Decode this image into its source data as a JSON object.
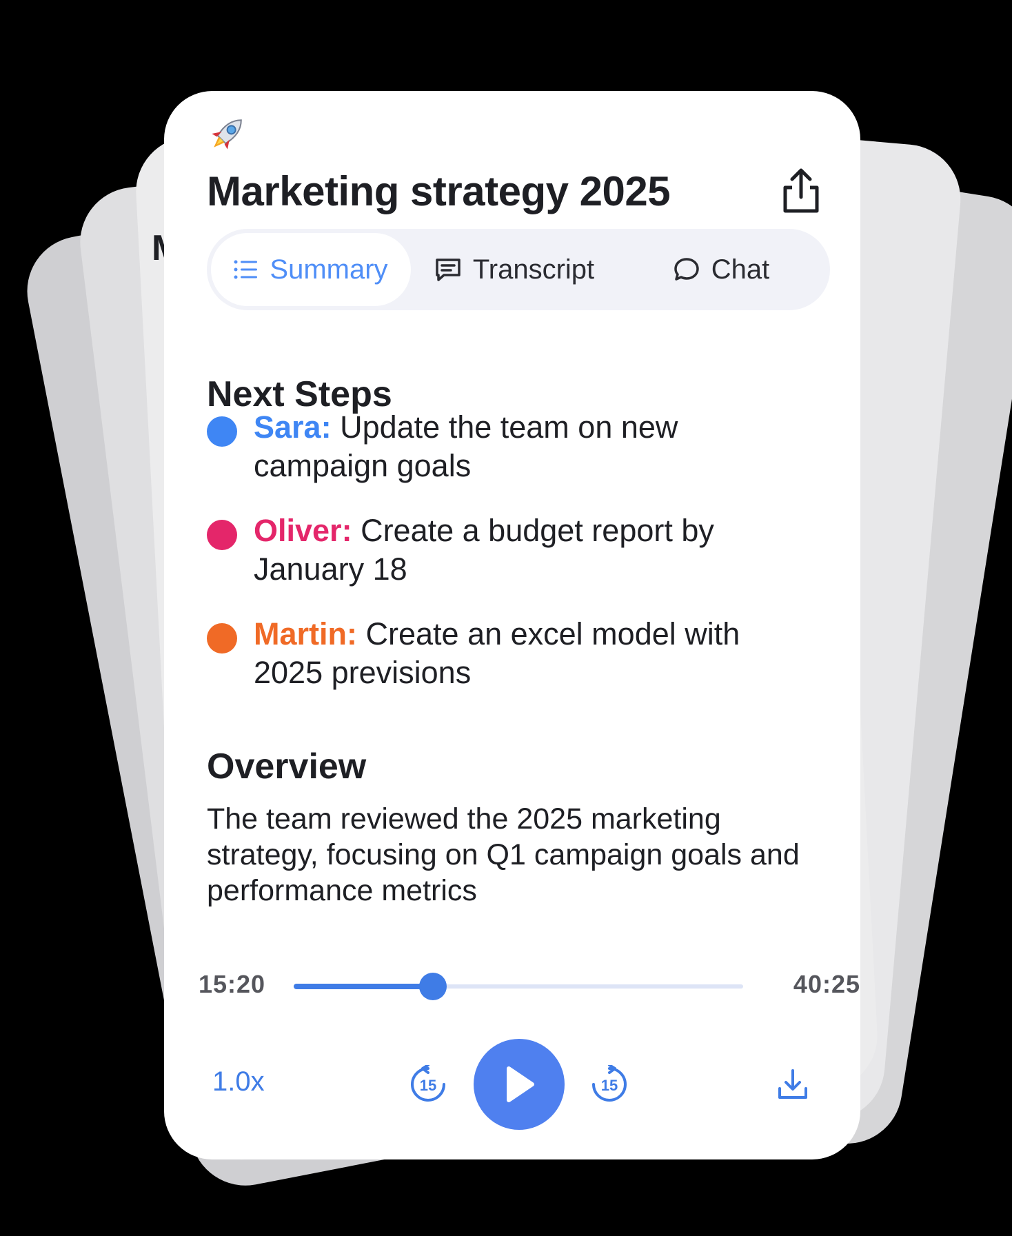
{
  "header": {
    "rocket_icon": "rocket-icon",
    "title": "Marketing strategy 2025",
    "share_icon": "share-icon"
  },
  "tabs": [
    {
      "label": "Summary",
      "icon": "list-icon",
      "active": true
    },
    {
      "label": "Transcript",
      "icon": "transcript-icon",
      "active": false
    },
    {
      "label": "Chat",
      "icon": "chat-bubble-icon",
      "active": false
    }
  ],
  "next_steps": {
    "heading": "Next Steps",
    "items": [
      {
        "person": "Sara:",
        "task": " Update the team on new campaign goals",
        "color": "#3f86f4"
      },
      {
        "person": "Oliver:",
        "task": " Create a budget report by January 18",
        "color": "#e4266a"
      },
      {
        "person": "Martin:",
        "task": " Create an excel model with 2025 previsions",
        "color": "#f06a26"
      }
    ]
  },
  "overview": {
    "heading": "Overview",
    "text": "The team reviewed the 2025 marketing strategy, focusing on Q1 campaign goals and performance metrics"
  },
  "player": {
    "current_time": "15:20",
    "total_time": "40:25",
    "progress": 0.31,
    "speed": "1.0x",
    "rewind_label": "15",
    "forward_label": "15",
    "accent_color": "#3f7ce6"
  },
  "background_peek": "M"
}
